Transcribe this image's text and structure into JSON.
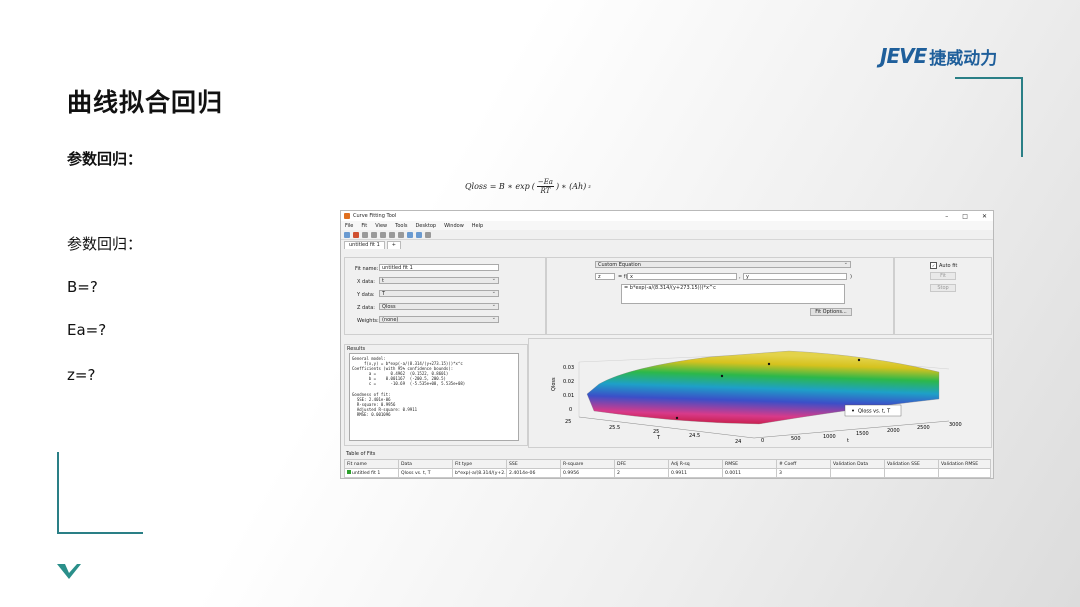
{
  "slide": {
    "title": "曲线拟合回归",
    "section1": "参数回归：",
    "section2": "参数回归：",
    "params": [
      "B=?",
      "Ea=?",
      "z=?"
    ]
  },
  "logo": {
    "latin": "JEVE",
    "chinese": "捷威动力"
  },
  "formula": {
    "lhs": "Qloss = B ∗ exp",
    "numerator": "−Ea",
    "denominator": "RT",
    "rhs": "∗ (Ah)",
    "exponent": "z"
  },
  "app": {
    "window_title": "Curve Fitting Tool",
    "menu": [
      "File",
      "Fit",
      "View",
      "Tools",
      "Desktop",
      "Window",
      "Help"
    ],
    "tab_label": "untitled fit 1",
    "fit_name_label": "Fit name:",
    "fit_name_value": "untitled fit 1",
    "x_label": "X data:",
    "x_value": "t",
    "y_label": "Y data:",
    "y_value": "T",
    "z_label": "Z data:",
    "z_value": "Qloss",
    "w_label": "Weights:",
    "w_value": "(none)",
    "equation_type": "Custom Equation",
    "eq_lhs_var": "z",
    "eq_f": "= f(",
    "eq_x": "x",
    "eq_y": "y",
    "eq_close": ")",
    "equation": "= b*exp(-a/(8.314/(y+273.15)))*x^c",
    "fit_options": "Fit Options...",
    "auto_fit": "Auto fit",
    "fit_button": "Fit",
    "stop_button": "Stop",
    "results_label": "Results",
    "results_text": "General model:\n     f(x,y) = b*exp(-a/(8.314/(y+273.15)))*x^c\nCoefficients (with 95% confidence bounds):\n       a =      0.4962  (0.1522, 0.8601)\n       b =    0.001167  (-200.5, 200.5)\n       c =      -10.69  (-5.535e+08, 5.535e+08)\n\nGoodness of fit:\n  SSE: 2.401e-06\n  R-square: 0.9956\n  Adjusted R-square: 0.9911\n  RMSE: 0.001096",
    "table_label": "Table of Fits",
    "table_headers": [
      "Fit name",
      "Data",
      "Fit type",
      "SSE",
      "R-square",
      "DFE",
      "Adj R-sq",
      "RMSE",
      "# Coeff",
      "Validation Data",
      "Validation SSE",
      "Validation RMSE"
    ],
    "table_rows": [
      [
        "untitled fit 1",
        "Qloss vs. t, T",
        "b*exp(-a/(8.314/(y+2...",
        "2.4014e-06",
        "0.9956",
        "2",
        "0.9911",
        "0.0011",
        "3",
        "",
        "",
        ""
      ]
    ],
    "plot": {
      "legend": "Qloss vs. t, T",
      "z_axis_label": "Qloss",
      "y_axis_label": "T",
      "x_axis_label": "t",
      "z_ticks": [
        "0.03",
        "0.02",
        "0.01",
        "0"
      ],
      "y_ticks": [
        "25",
        "25.5",
        "25",
        "24.5",
        "24"
      ],
      "x_ticks": [
        "0",
        "500",
        "1000",
        "1500",
        "2000",
        "2500",
        "3000"
      ]
    }
  }
}
